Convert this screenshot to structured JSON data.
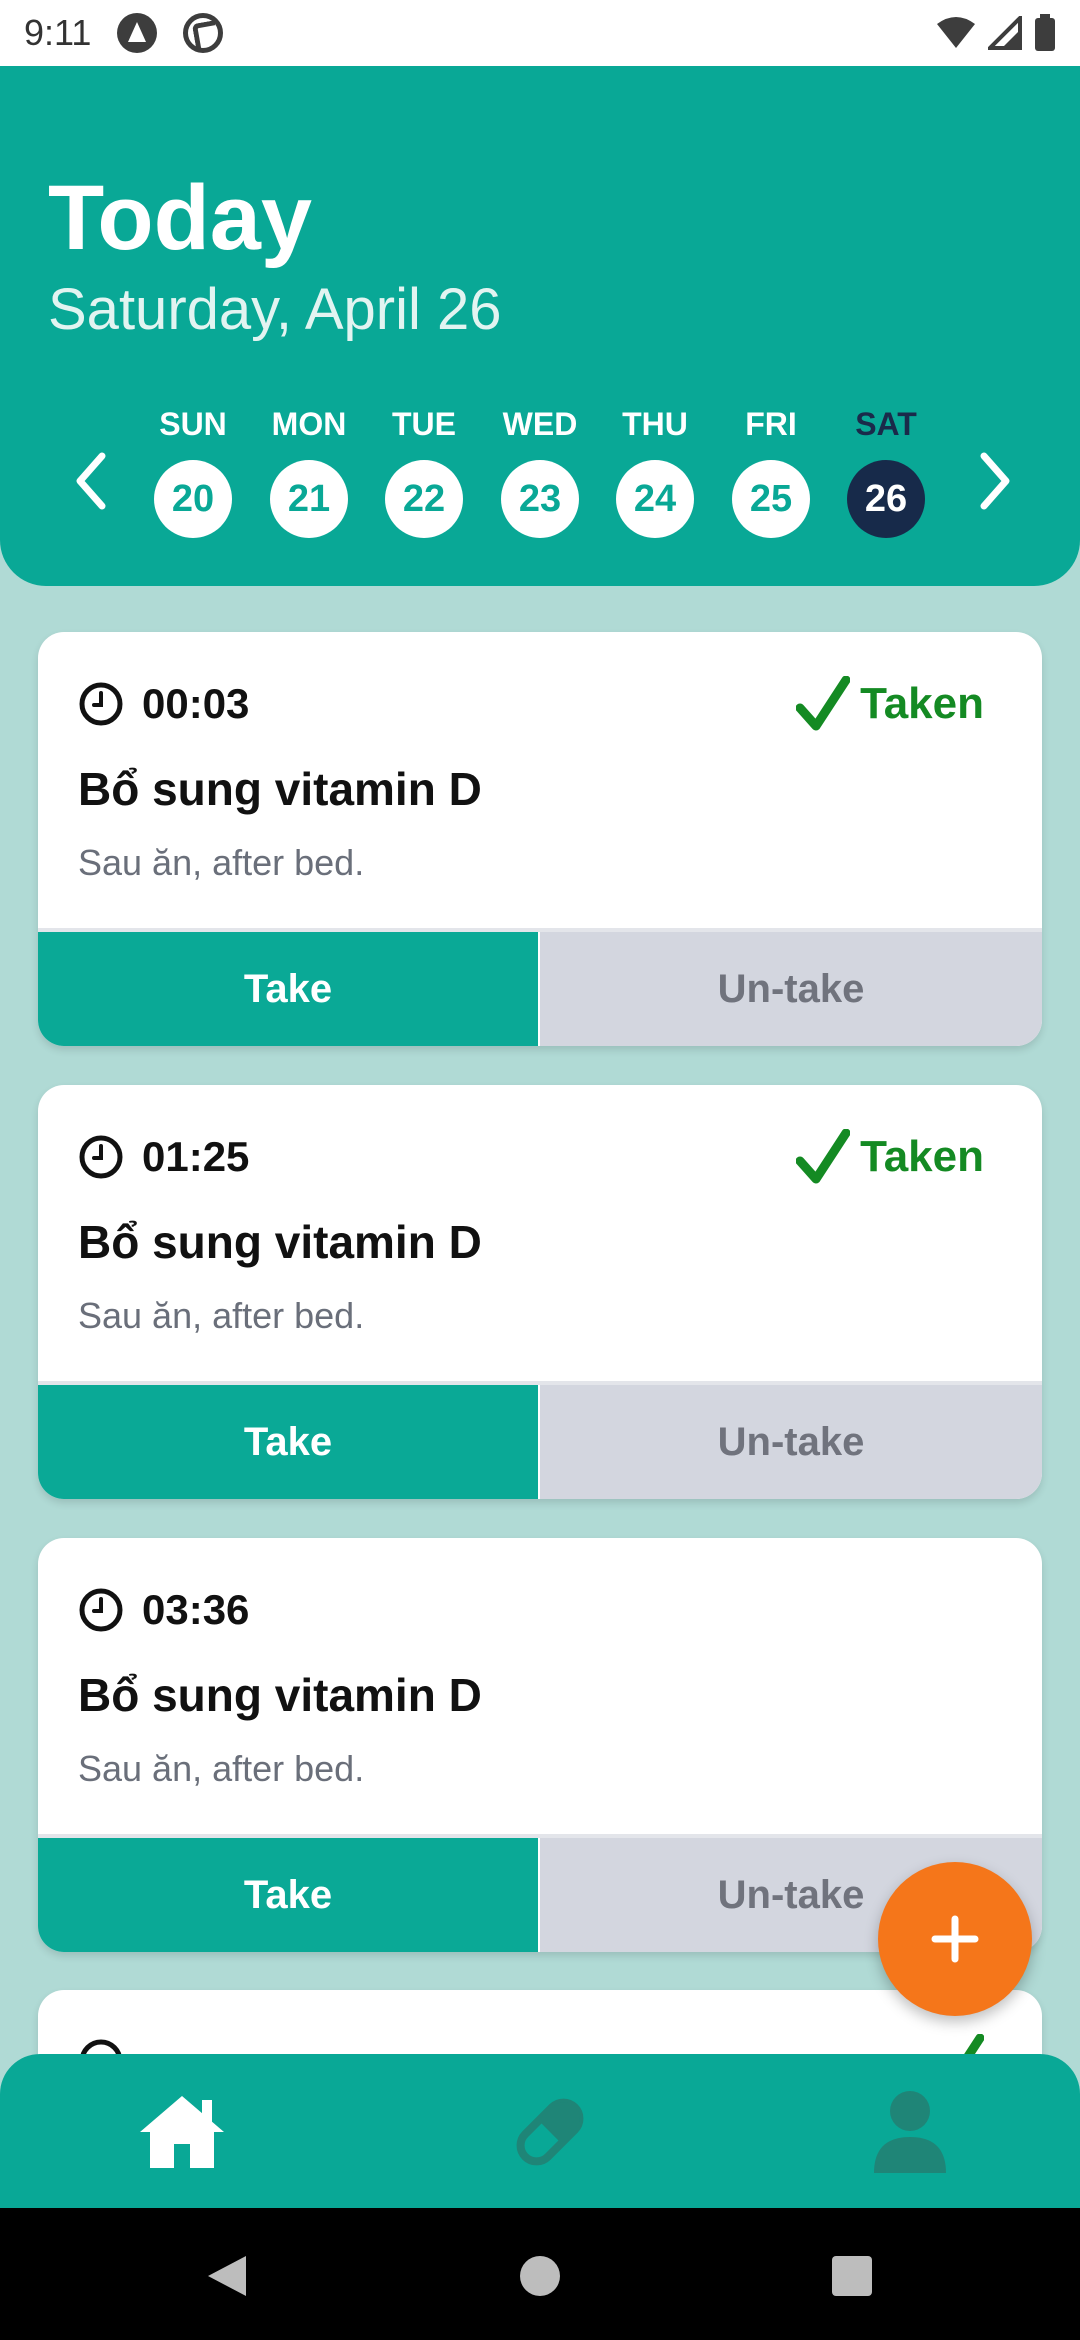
{
  "status_bar": {
    "time": "9:11"
  },
  "header": {
    "title": "Today",
    "subtitle": "Saturday, April 26"
  },
  "week": {
    "days": [
      {
        "name": "SUN",
        "num": "20"
      },
      {
        "name": "MON",
        "num": "21"
      },
      {
        "name": "TUE",
        "num": "22"
      },
      {
        "name": "WED",
        "num": "23"
      },
      {
        "name": "THU",
        "num": "24"
      },
      {
        "name": "FRI",
        "num": "25"
      },
      {
        "name": "SAT",
        "num": "26"
      }
    ],
    "selected_index": 6
  },
  "reminders": [
    {
      "time": "00:03",
      "status": "Taken",
      "name": "Bổ sung vitamin D",
      "note": "Sau ăn, after bed.",
      "take_label": "Take",
      "untake_label": "Un-take"
    },
    {
      "time": "01:25",
      "status": "Taken",
      "name": "Bổ sung vitamin D",
      "note": "Sau ăn, after bed.",
      "take_label": "Take",
      "untake_label": "Un-take"
    },
    {
      "time": "03:36",
      "status": "",
      "name": "Bổ sung vitamin D",
      "note": "Sau ăn, after bed.",
      "take_label": "Take",
      "untake_label": "Un-take"
    }
  ],
  "colors": {
    "primary": "#09a896",
    "selected_day": "#172a4a",
    "taken": "#148a23",
    "fab": "#f5761a",
    "background": "#b0dad5"
  },
  "icons": {
    "prev": "chevron-left-icon",
    "next": "chevron-right-icon",
    "clock": "clock-icon",
    "check": "check-icon",
    "add": "plus-icon",
    "home": "home-icon",
    "medicine": "pill-icon",
    "profile": "user-icon"
  }
}
